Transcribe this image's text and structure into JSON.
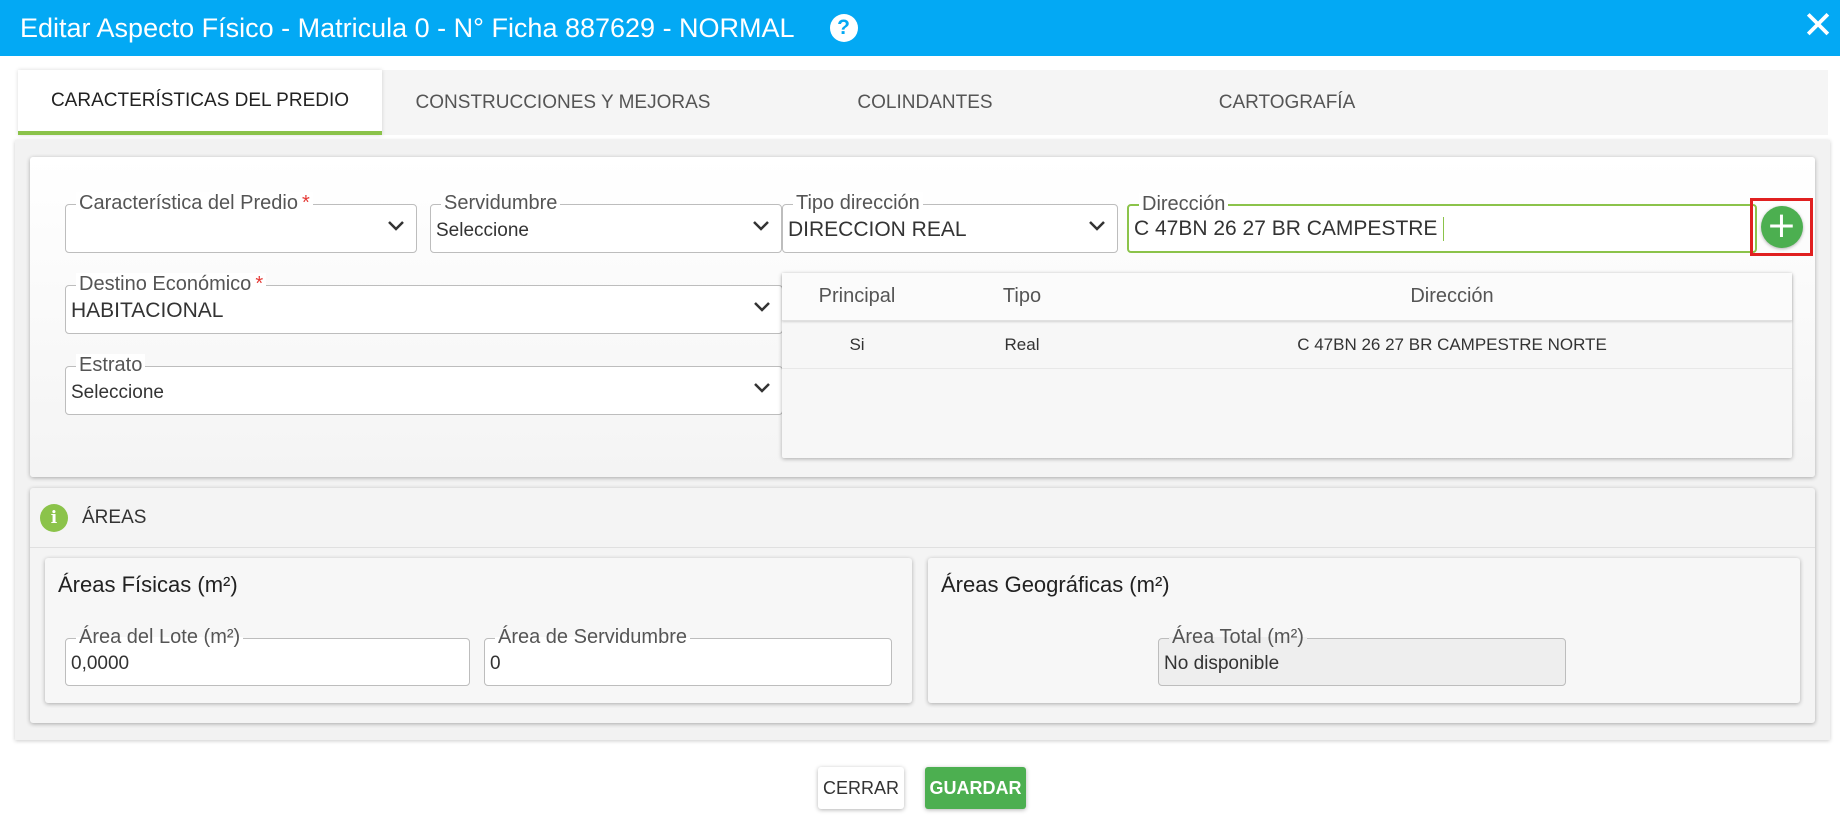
{
  "window": {
    "title": "Editar Aspecto Físico - Matricula 0 - N° Ficha 887629 - NORMAL",
    "help_icon": "?",
    "close_icon": "✕"
  },
  "tabs": [
    {
      "label": "Características del Predio",
      "active": true
    },
    {
      "label": "Construcciones y Mejoras",
      "active": false
    },
    {
      "label": "Colindantes",
      "active": false
    },
    {
      "label": "Cartografía",
      "active": false
    }
  ],
  "predio": {
    "caracteristica": {
      "label": "Característica del Predio",
      "required": "*",
      "value": ""
    },
    "servidumbre": {
      "label": "Servidumbre",
      "value": "Seleccione"
    },
    "tipo_direccion": {
      "label": "Tipo dirección",
      "value": "DIRECCION REAL"
    },
    "direccion": {
      "label": "Dirección",
      "value": "C 47BN 26 27 BR CAMPESTRE"
    },
    "destino": {
      "label": "Destino Económico",
      "required": "*",
      "value": "HABITACIONAL"
    },
    "estrato": {
      "label": "Estrato",
      "value": "Seleccione"
    },
    "add_button": "+"
  },
  "direcciones_table": {
    "headers": [
      "Principal",
      "Tipo",
      "Dirección"
    ],
    "rows": [
      {
        "principal": "Si",
        "tipo": "Real",
        "direccion": "C 47BN 26 27 BR CAMPESTRE NORTE"
      }
    ]
  },
  "areas": {
    "title": "ÁREAS",
    "info_icon": "i",
    "fisicas": {
      "title": "Áreas Físicas (m²)",
      "lote": {
        "label": "Área del Lote (m²)",
        "value": "0,0000"
      },
      "servidumbre": {
        "label": "Área de Servidumbre",
        "value": "0"
      }
    },
    "geograficas": {
      "title": "Áreas Geográficas (m²)",
      "total": {
        "label": "Área Total (m²)",
        "value": "No disponible"
      }
    }
  },
  "footer": {
    "close_label": "CERRAR",
    "save_label": "GUARDAR"
  },
  "colors": {
    "header": "#03a9f4",
    "accent_green": "#8bc34a",
    "button_green": "#4caf50",
    "highlight_red": "#e02020"
  }
}
